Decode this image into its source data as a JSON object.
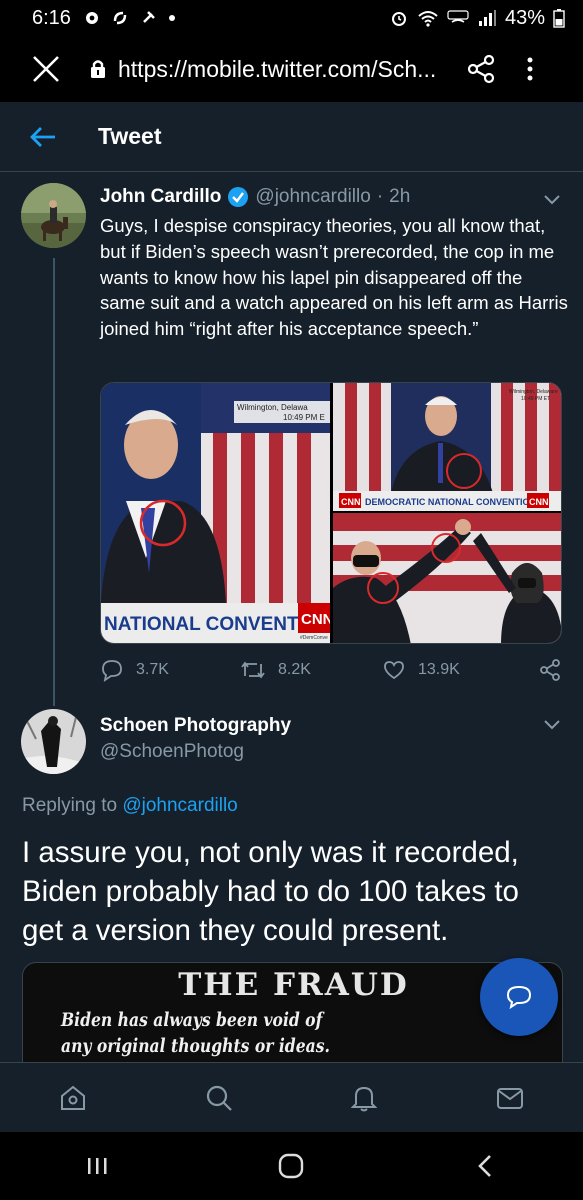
{
  "status_bar": {
    "time": "6:16",
    "battery": "43%"
  },
  "browser": {
    "url": "https://mobile.twitter.com/Sch..."
  },
  "header": {
    "title": "Tweet"
  },
  "main_tweet": {
    "author_name": "John Cardillo",
    "author_handle": "@johncardillo",
    "separator": "·",
    "time": "2h",
    "text": "Guys, I despise conspiracy theories, you all know that, but if Biden’s speech wasn’t prerecorded, the cop in me wants to know how his lapel pin disappeared off the same suit and a watch appeared on his left arm as Harris joined him “right after his acceptance speech.”",
    "media": {
      "left_caption_line1": "Wilmington, Delawa",
      "left_caption_line2": "10:49 PM E",
      "left_banner": "NATIONAL CONVENTION",
      "right_caption_line1": "Wilmington, Delaware",
      "right_caption_line2": "10:49 PM ET",
      "right_banner": "DEMOCRATIC NATIONAL CONVENTION",
      "cnn_logo": "CNN",
      "cnn_small": "#DemConve"
    },
    "replies": "3.7K",
    "retweets": "8.2K",
    "likes": "13.9K"
  },
  "reply_tweet": {
    "author_name": "Schoen Photography",
    "author_handle": "@SchoenPhotog",
    "replying_prefix": "Replying to",
    "replying_to": "@johncardillo",
    "text": "I assure you, not only was it recorded, Biden probably had to do 100 takes to get a version they could present.",
    "card_title": "THE FRAUD",
    "card_subtitle": "Biden has always been void of any original thoughts or ideas. Biden is a plagiarist, he"
  },
  "colors": {
    "background": "#15202b",
    "accent": "#1da1f2",
    "muted": "#8899a6",
    "fab": "#1a56b8"
  }
}
